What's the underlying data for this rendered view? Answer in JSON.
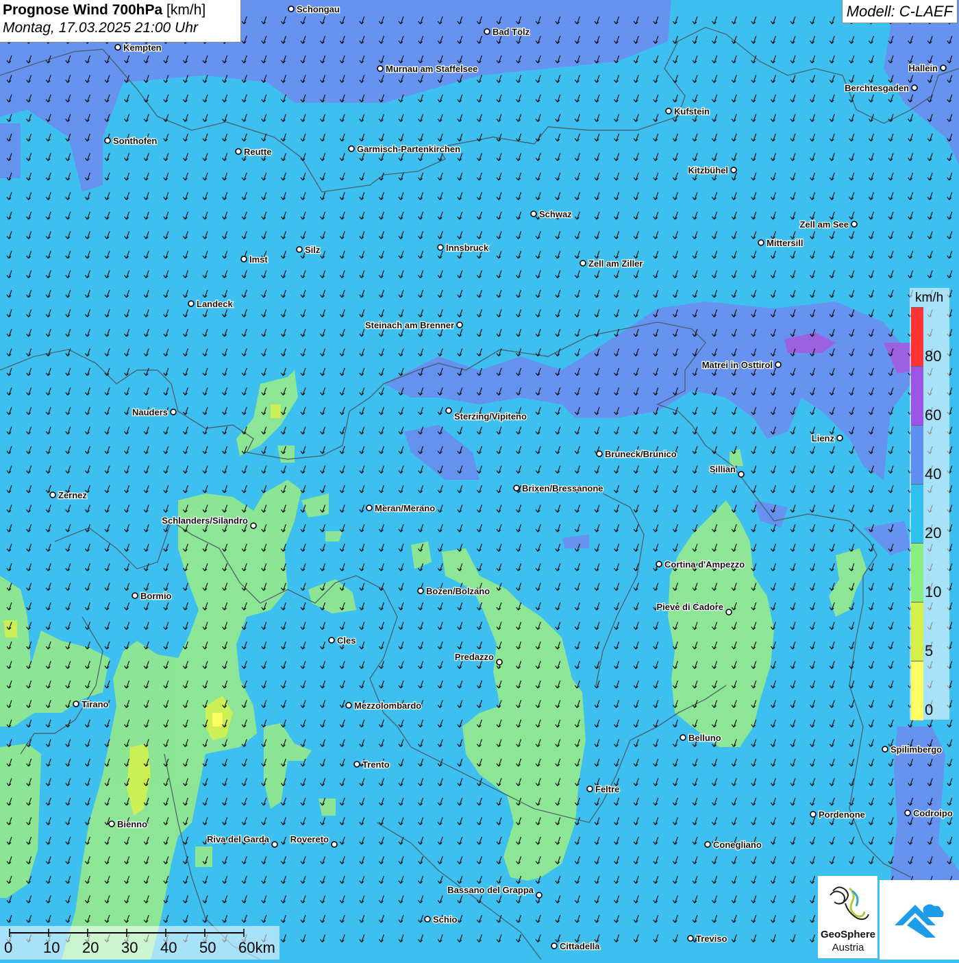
{
  "title": {
    "main": "Prognose Wind 700hPa",
    "unit": "[km/h]",
    "datetime": "Montag, 17.03.2025 21:00 Uhr"
  },
  "model": "Modell: C-LAEF",
  "legend": {
    "unit": "km/h",
    "labels": [
      "80",
      "60",
      "40",
      "20",
      "10",
      "5",
      "0"
    ],
    "colors": [
      "#ff3333",
      "#9a55e6",
      "#5e8ff0",
      "#30c0ee",
      "#88ee80",
      "#d6f04a",
      "#ffff66"
    ]
  },
  "scalebar": {
    "labels": [
      "0",
      "10",
      "20",
      "30",
      "40",
      "50",
      "60km"
    ]
  },
  "branding": {
    "name": "GeoSphere",
    "country": "Austria"
  },
  "colors": {
    "field_20_40": "#3dbfef",
    "field_40_60": "#6a8df0",
    "field_60_80": "#a25be0",
    "field_10_20": "#90e890",
    "field_5_10": "#d6f04a",
    "field_0_5": "#ffff66"
  },
  "places": [
    {
      "name": "Schongau"
    },
    {
      "name": "Bad Tölz"
    },
    {
      "name": "Kempten"
    },
    {
      "name": "Murnau am Staffelsee"
    },
    {
      "name": "Hallein"
    },
    {
      "name": "Berchtesgaden"
    },
    {
      "name": "Kufstein"
    },
    {
      "name": "Sonthofen"
    },
    {
      "name": "Reutte"
    },
    {
      "name": "Garmisch-Partenkirchen"
    },
    {
      "name": "Kitzbühel"
    },
    {
      "name": "Schwaz"
    },
    {
      "name": "Zell am See"
    },
    {
      "name": "Mittersill"
    },
    {
      "name": "Silz"
    },
    {
      "name": "Innsbruck"
    },
    {
      "name": "Imst"
    },
    {
      "name": "Zell am Ziller"
    },
    {
      "name": "Landeck"
    },
    {
      "name": "Steinach am Brenner"
    },
    {
      "name": "Matrei in Osttirol"
    },
    {
      "name": "Nauders"
    },
    {
      "name": "Sterzing/Vipiteno"
    },
    {
      "name": "Lienz"
    },
    {
      "name": "Bruneck/Brunico"
    },
    {
      "name": "Sillian"
    },
    {
      "name": "Zernez"
    },
    {
      "name": "Brixen/Bressanone"
    },
    {
      "name": "Meran/Merano"
    },
    {
      "name": "Schlanders/Silandro"
    },
    {
      "name": "Cortina d'Ampezzo"
    },
    {
      "name": "Bozen/Bolzano"
    },
    {
      "name": "Bormio"
    },
    {
      "name": "Pieve di Cadore"
    },
    {
      "name": "Cles"
    },
    {
      "name": "Predazzo"
    },
    {
      "name": "Tirano"
    },
    {
      "name": "Mezzolombardo"
    },
    {
      "name": "Belluno"
    },
    {
      "name": "Spilimbergo"
    },
    {
      "name": "Trento"
    },
    {
      "name": "Feltre"
    },
    {
      "name": "Pordenone"
    },
    {
      "name": "Codroipo"
    },
    {
      "name": "Bienno"
    },
    {
      "name": "Riva del Garda"
    },
    {
      "name": "Rovereto"
    },
    {
      "name": "Conegliano"
    },
    {
      "name": "Bassano del Grappa"
    },
    {
      "name": "Schio"
    },
    {
      "name": "Treviso"
    },
    {
      "name": "Cittadella"
    }
  ]
}
